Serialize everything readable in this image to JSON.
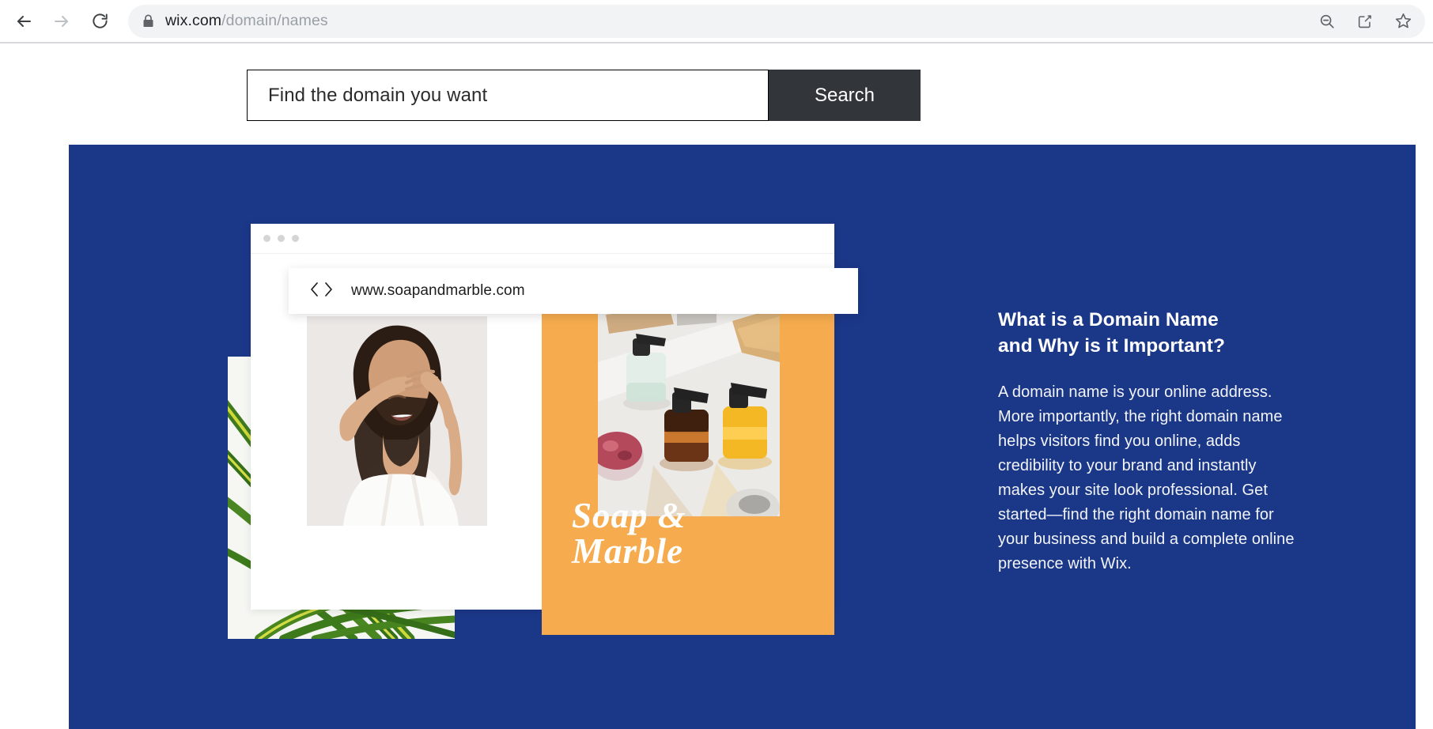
{
  "browser": {
    "back_icon": "arrow-left-icon",
    "forward_icon": "arrow-right-icon",
    "reload_icon": "reload-icon",
    "lock_icon": "lock-icon",
    "url_host": "wix.com",
    "url_path": "/domain/names",
    "zoom_out_icon": "zoom-out-icon",
    "share_icon": "share-icon",
    "bookmark_icon": "star-outline-icon"
  },
  "search": {
    "placeholder": "Find the domain you want",
    "value": "",
    "button_label": "Search"
  },
  "hero": {
    "background_color": "#1b3788",
    "mock_site": {
      "url": "www.soapandmarble.com",
      "back_chevron_icon": "chevron-left-icon",
      "forward_chevron_icon": "chevron-right-icon",
      "brand_wordmark": "Soap &\nMarble",
      "accent_color": "#f5ab4e",
      "woman_photo_alt": "woman-skincare-photo",
      "soap_photo_alt": "soap-dispenser-bottles-photo",
      "palm_photo_alt": "palm-leaf-photo"
    },
    "copy": {
      "title": "What is a Domain Name\nand Why is it Important?",
      "body": "A domain name is your online address. More importantly, the right domain name helps visitors find you online, adds credibility to your brand and instantly makes your site look professional. Get started—find the right domain name for your business and build a complete online presence with Wix."
    }
  }
}
